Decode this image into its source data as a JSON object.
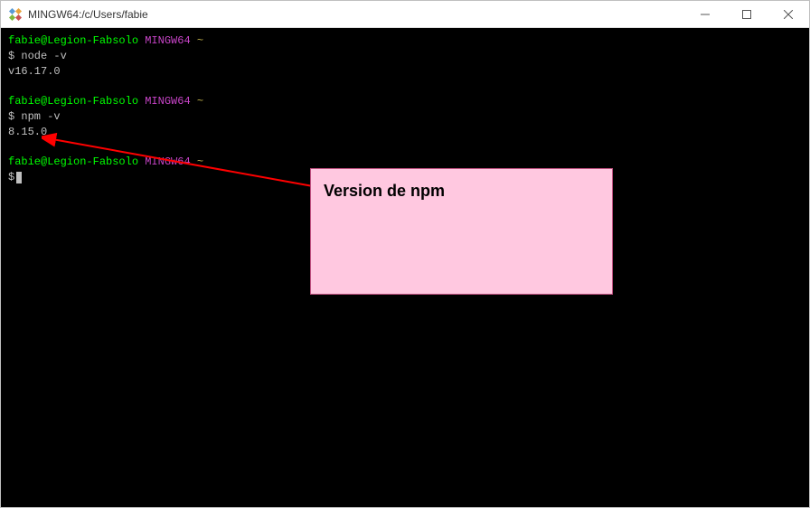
{
  "window": {
    "title": "MINGW64:/c/Users/fabie"
  },
  "terminal": {
    "prompt": {
      "user_host": "fabie@Legion-Fabsolo",
      "shell": "MINGW64",
      "path": "~",
      "symbol": "$"
    },
    "block1": {
      "command": "node -v",
      "output": "v16.17.0"
    },
    "block2": {
      "command": "npm -v",
      "output": "8.15.0"
    }
  },
  "annotation": {
    "text": "Version de npm"
  }
}
